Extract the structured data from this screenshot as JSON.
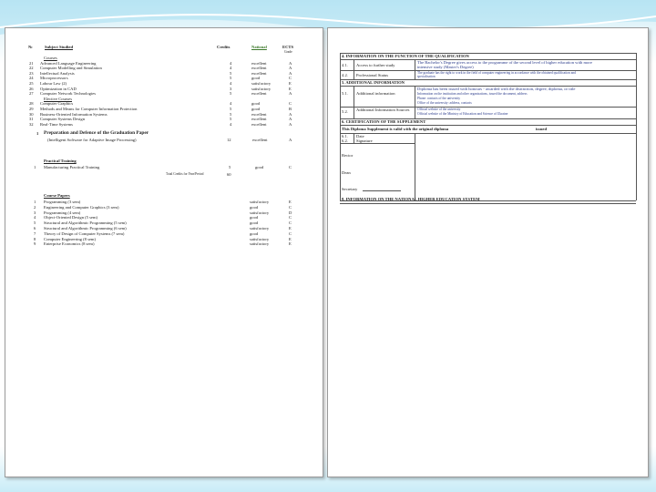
{
  "header": {
    "no": "№",
    "subjects": "Subject Studied",
    "credits": "Credits",
    "national": "National",
    "ects": "ECTS",
    "ects_sub": "Grade"
  },
  "courses": [
    {
      "no": "",
      "name": "Courses",
      "credits": "",
      "grade": "",
      "ects": ""
    },
    {
      "no": "21",
      "name": "Advanced Language Engineering",
      "credits": "4",
      "grade": "excellent",
      "ects": "A"
    },
    {
      "no": "22",
      "name": "Computer Modelling and Simulation",
      "credits": "4",
      "grade": "excellent",
      "ects": "A"
    },
    {
      "no": "23",
      "name": "Intellectual Analysis",
      "credits": "5",
      "grade": "excellent",
      "ects": "A"
    },
    {
      "no": "24",
      "name": "Microprocessors",
      "credits": "5",
      "grade": "good",
      "ects": "C"
    },
    {
      "no": "25",
      "name": "Labour Law (2)",
      "credits": "4",
      "grade": "satisfactory",
      "ects": "E"
    },
    {
      "no": "26",
      "name": "Optimization in CAD",
      "credits": "3",
      "grade": "satisfactory",
      "ects": "E"
    },
    {
      "no": "27",
      "name": "Computer Network Technologies",
      "credits": "5",
      "grade": "excellent",
      "ects": "A"
    },
    {
      "no": "",
      "name": "Elective Courses",
      "credits": "",
      "grade": "",
      "ects": ""
    },
    {
      "no": "28",
      "name": "Computer Graphics",
      "credits": "4",
      "grade": "good",
      "ects": "C"
    },
    {
      "no": "29",
      "name": "Methods and Means for Computer Information Protection",
      "credits": "5",
      "grade": "good",
      "ects": "B"
    },
    {
      "no": "30",
      "name": "Business-Oriented Information Systems",
      "credits": "5",
      "grade": "excellent",
      "ects": "A"
    },
    {
      "no": "31",
      "name": "Computer Systems Design",
      "credits": "5",
      "grade": "excellent",
      "ects": "A"
    },
    {
      "no": "32",
      "name": "Real-Time Systems",
      "credits": "4",
      "grade": "excellent",
      "ects": "A"
    }
  ],
  "thesis": {
    "no": "1",
    "title": "Preparation and Defence of the Graduation Paper",
    "subtitle": "(Intelligent Software for Adaptive Image Processing)",
    "credits": "12",
    "grade": "excellent",
    "ects": "A"
  },
  "practical": {
    "heading": "Practical Training",
    "no": "1",
    "name": "Manufacturing Practical Training",
    "credits": "5",
    "grade": "good",
    "ects": "C",
    "total_label": "Total Credits for Year/Period",
    "total": "60"
  },
  "coursepapers": {
    "heading": "Course Papers",
    "rows": [
      {
        "no": "1",
        "name": "Programming (3 sem)",
        "grade": "satisfactory",
        "ects": "E"
      },
      {
        "no": "2",
        "name": "Engineering and Computer Graphics (3 sem)",
        "grade": "good",
        "ects": "C"
      },
      {
        "no": "3",
        "name": "Programming (4 sem)",
        "grade": "satisfactory",
        "ects": "D"
      },
      {
        "no": "4",
        "name": "Object-Oriented Design (5 sem)",
        "grade": "good",
        "ects": "C"
      },
      {
        "no": "5",
        "name": "Structural and Algorithmic Programming (5 sem)",
        "grade": "good",
        "ects": "C"
      },
      {
        "no": "6",
        "name": "Structural and Algorithmic Programming (6 sem)",
        "grade": "satisfactory",
        "ects": "E"
      },
      {
        "no": "7",
        "name": "Theory of Design of Computer Systems (7 sem)",
        "grade": "good",
        "ects": "C"
      },
      {
        "no": "8",
        "name": "Computer Engineering (8 sem)",
        "grade": "satisfactory",
        "ects": "E"
      },
      {
        "no": "9",
        "name": "Enterprise Economics (8 sem)",
        "grade": "satisfactory",
        "ects": "E"
      }
    ]
  },
  "right": {
    "s4": "4. INFORMATION ON THE FUNCTION OF THE QUALIFICATION",
    "s4_1_num": "4.1.",
    "s4_1_label": "Access to further study",
    "s4_1_text1": "The Bachelor's Degree gives access to the programme of the second level of higher education with more",
    "s4_1_text2": "intensive study (Master's Degree)",
    "s4_2_num": "4.2.",
    "s4_2_label": "Professional Status",
    "s4_2_text1": "The graduate has the right to work in the field of computer engineering in accordance with the obtained qualification and",
    "s4_2_text2": "specialisation",
    "s5": "5. ADDITIONAL INFORMATION",
    "s5_1_num": "5.1.",
    "s5_1_label": "Additional information",
    "s5_1_text1": "Diploma has been issued with honours - awarded with the distinction, degree, diploma, or title",
    "s5_1_text2": "Information on the institution and other organisations, issued the document, address",
    "s5_1_text3": "Phone: contacts of the university",
    "s5_1_text4": "Office of the university: address, contacts",
    "s5_2_num": "5.2.",
    "s5_2_label": "Additional Information Sources",
    "s5_2_text1": "Official website of the university",
    "s5_2_text2": "Official website of the Ministry of Education and Science of Ukraine",
    "s6": "6. CERTIFICATION OF THE SUPPLEMENT",
    "s6_text": "This Diploma Supplement is valid with the original diploma",
    "s6_text2": "issued",
    "s6_1_num": "6.1.",
    "s6_1_label": "Date",
    "s6_2_num": "6.2.",
    "s6_2_label": "Signature",
    "rector": "Rector",
    "dean": "Dean",
    "secretary": "Secretary",
    "s8": "8. INFORMATION ON THE NATIONAL HIGHER EDUCATION SYSTEM"
  }
}
